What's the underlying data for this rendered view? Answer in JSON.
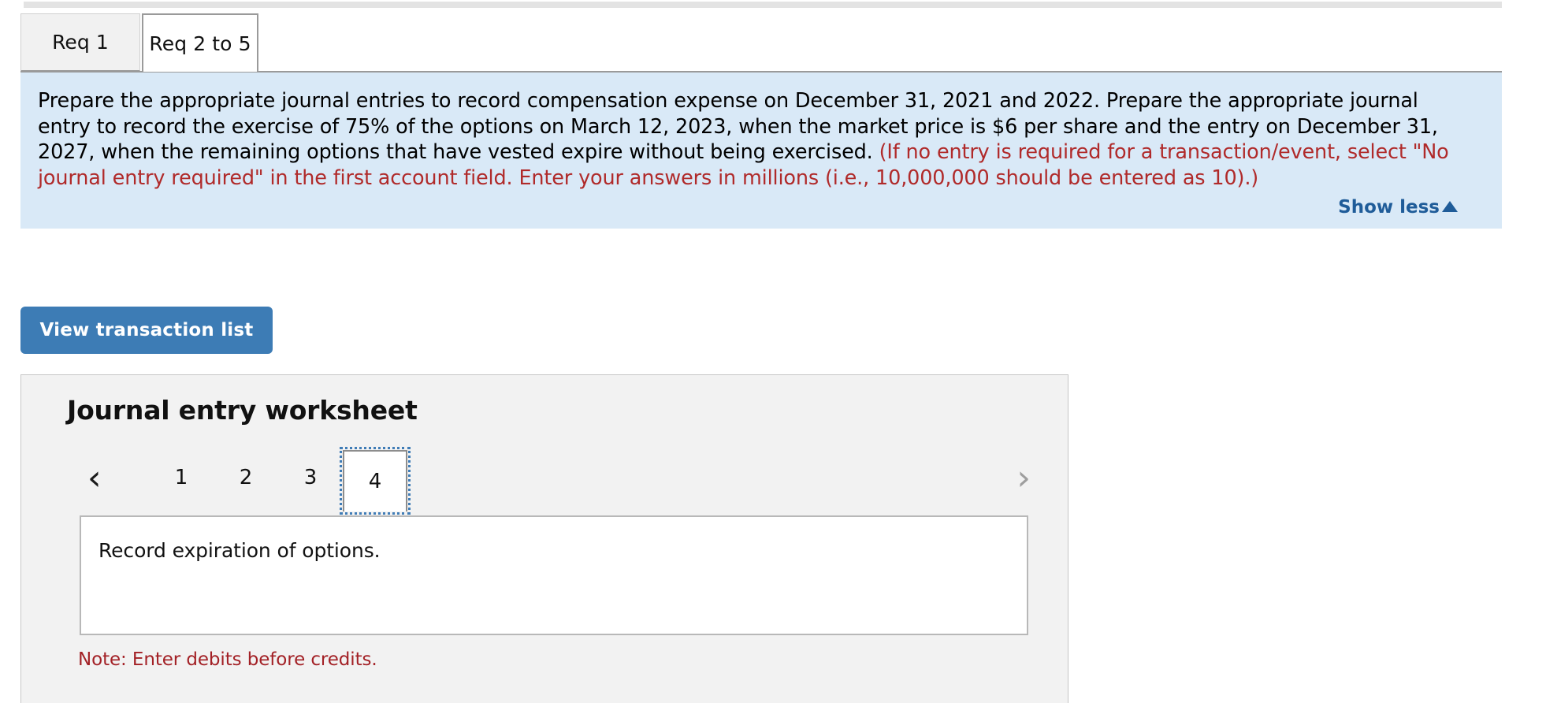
{
  "tabs": [
    {
      "label": "Req 1",
      "active": false
    },
    {
      "label": "Req 2 to 5",
      "active": true
    }
  ],
  "instruction": {
    "main": "Prepare the appropriate journal entries to record compensation expense on December 31, 2021 and 2022. Prepare the appropriate journal entry to record the exercise of 75% of the options on March 12, 2023, when the market price is $6 per share and the entry on December 31, 2027, when the remaining options that have vested expire without being exercised. ",
    "hint": "(If no entry is required for a transaction/event, select \"No journal entry required\" in the first account field. Enter your answers in millions (i.e., 10,000,000 should be entered as 10).)",
    "show_less_label": "Show less",
    "show_less_caret": "caret-up-icon",
    "background_color": "#d9e9f7",
    "hint_color": "#b02a2a",
    "link_color": "#1f5c99"
  },
  "toolbar": {
    "view_transaction_list_label": "View transaction list",
    "button_color": "#3d7cb5"
  },
  "worksheet": {
    "title": "Journal entry worksheet",
    "pager": {
      "prev_icon": "chevron-left-icon",
      "prev_glyph": "‹",
      "next_icon": "chevron-right-icon",
      "next_glyph": "›",
      "pages": [
        "1",
        "2",
        "3",
        "4"
      ],
      "selected_page": "4"
    },
    "description": "Record expiration of options.",
    "note": "Note: Enter debits before credits.",
    "note_color": "#a32126"
  }
}
